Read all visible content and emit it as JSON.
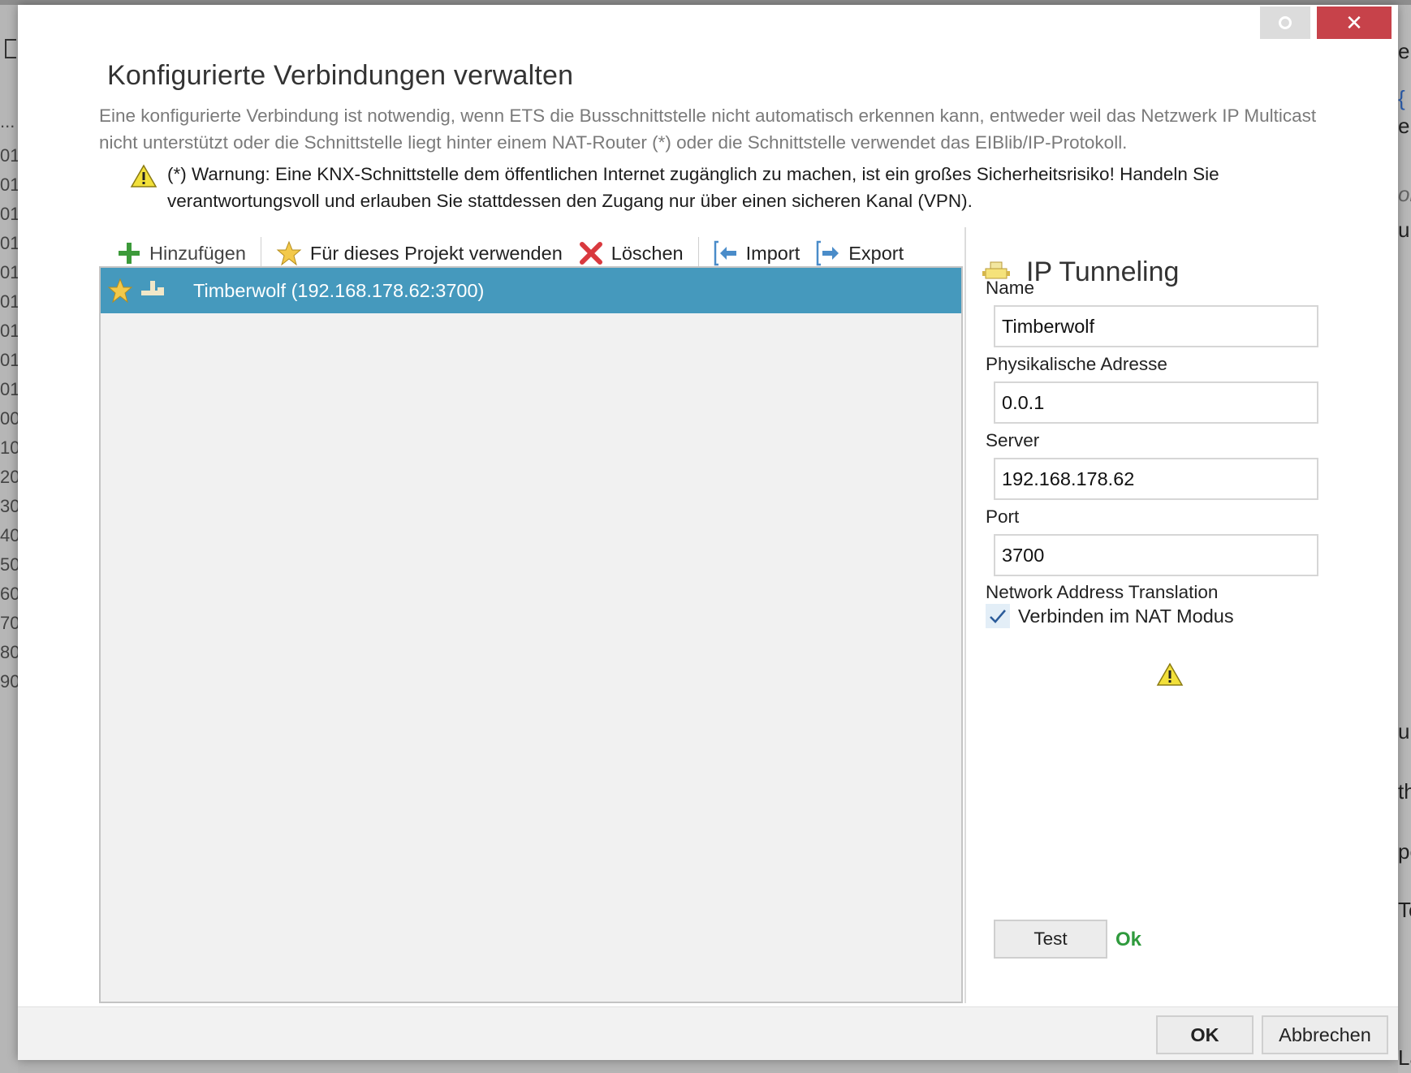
{
  "dialog": {
    "title": "Konfigurierte Verbindungen verwalten",
    "description": "Eine konfigurierte Verbindung ist notwendig, wenn ETS die Busschnittstelle nicht automatisch erkennen kann, entweder weil das Netzwerk IP Multicast nicht unterstützt oder die Schnittstelle liegt hinter einem NAT-Router (*) oder die Schnittstelle verwendet das EIBlib/IP-Protokoll.",
    "warning": "(*) Warnung: Eine KNX-Schnittstelle dem öffentlichen Internet zugänglich zu machen, ist ein großes Sicherheitsrisiko! Handeln Sie verantwortungsvoll und erlauben Sie stattdessen den Zugang nur über einen sicheren Kanal (VPN).",
    "close_glyph": "✕"
  },
  "toolbar": {
    "add_label": "Hinzufügen",
    "use_label": "Für dieses Projekt verwenden",
    "delete_label": "Löschen",
    "import_label": "Import",
    "export_label": "Export"
  },
  "connections": [
    {
      "label": "Timberwolf (192.168.178.62:3700)",
      "selected": true,
      "favorite": true
    }
  ],
  "detail": {
    "title": "IP Tunneling",
    "name_label": "Name",
    "name_value": "Timberwolf",
    "address_label": "Physikalische Adresse",
    "address_value": "0.0.1",
    "server_label": "Server",
    "server_value": "192.168.178.62",
    "port_label": "Port",
    "port_value": "3700",
    "nat_section_label": "Network Address Translation",
    "nat_checkbox_label": "Verbinden im NAT Modus",
    "nat_checked": true,
    "test_label": "Test",
    "test_status": "Ok"
  },
  "footer": {
    "ok_label": "OK",
    "cancel_label": "Abbrechen"
  },
  "background": {
    "left_rows": [
      "...",
      "01",
      "01",
      "01",
      "01",
      "01",
      "01",
      "01",
      "01",
      "01",
      "00",
      "10",
      "20",
      "30",
      "40",
      "50",
      "60",
      "70",
      "80",
      "90"
    ],
    "right_rows": [
      "er",
      "{",
      "el",
      "ol",
      "u",
      "up",
      "th",
      "pe",
      "Te",
      "Lauf"
    ]
  },
  "colors": {
    "selection": "#4599bd",
    "close_button": "#c7424a",
    "status_ok": "#2f9a3d",
    "warning": "#f2e03a"
  },
  "icons": [
    "add-icon",
    "star-icon",
    "delete-icon",
    "import-icon",
    "export-icon",
    "warning-icon",
    "ip-tunneling-icon",
    "check-icon",
    "close-icon",
    "restore-icon"
  ]
}
